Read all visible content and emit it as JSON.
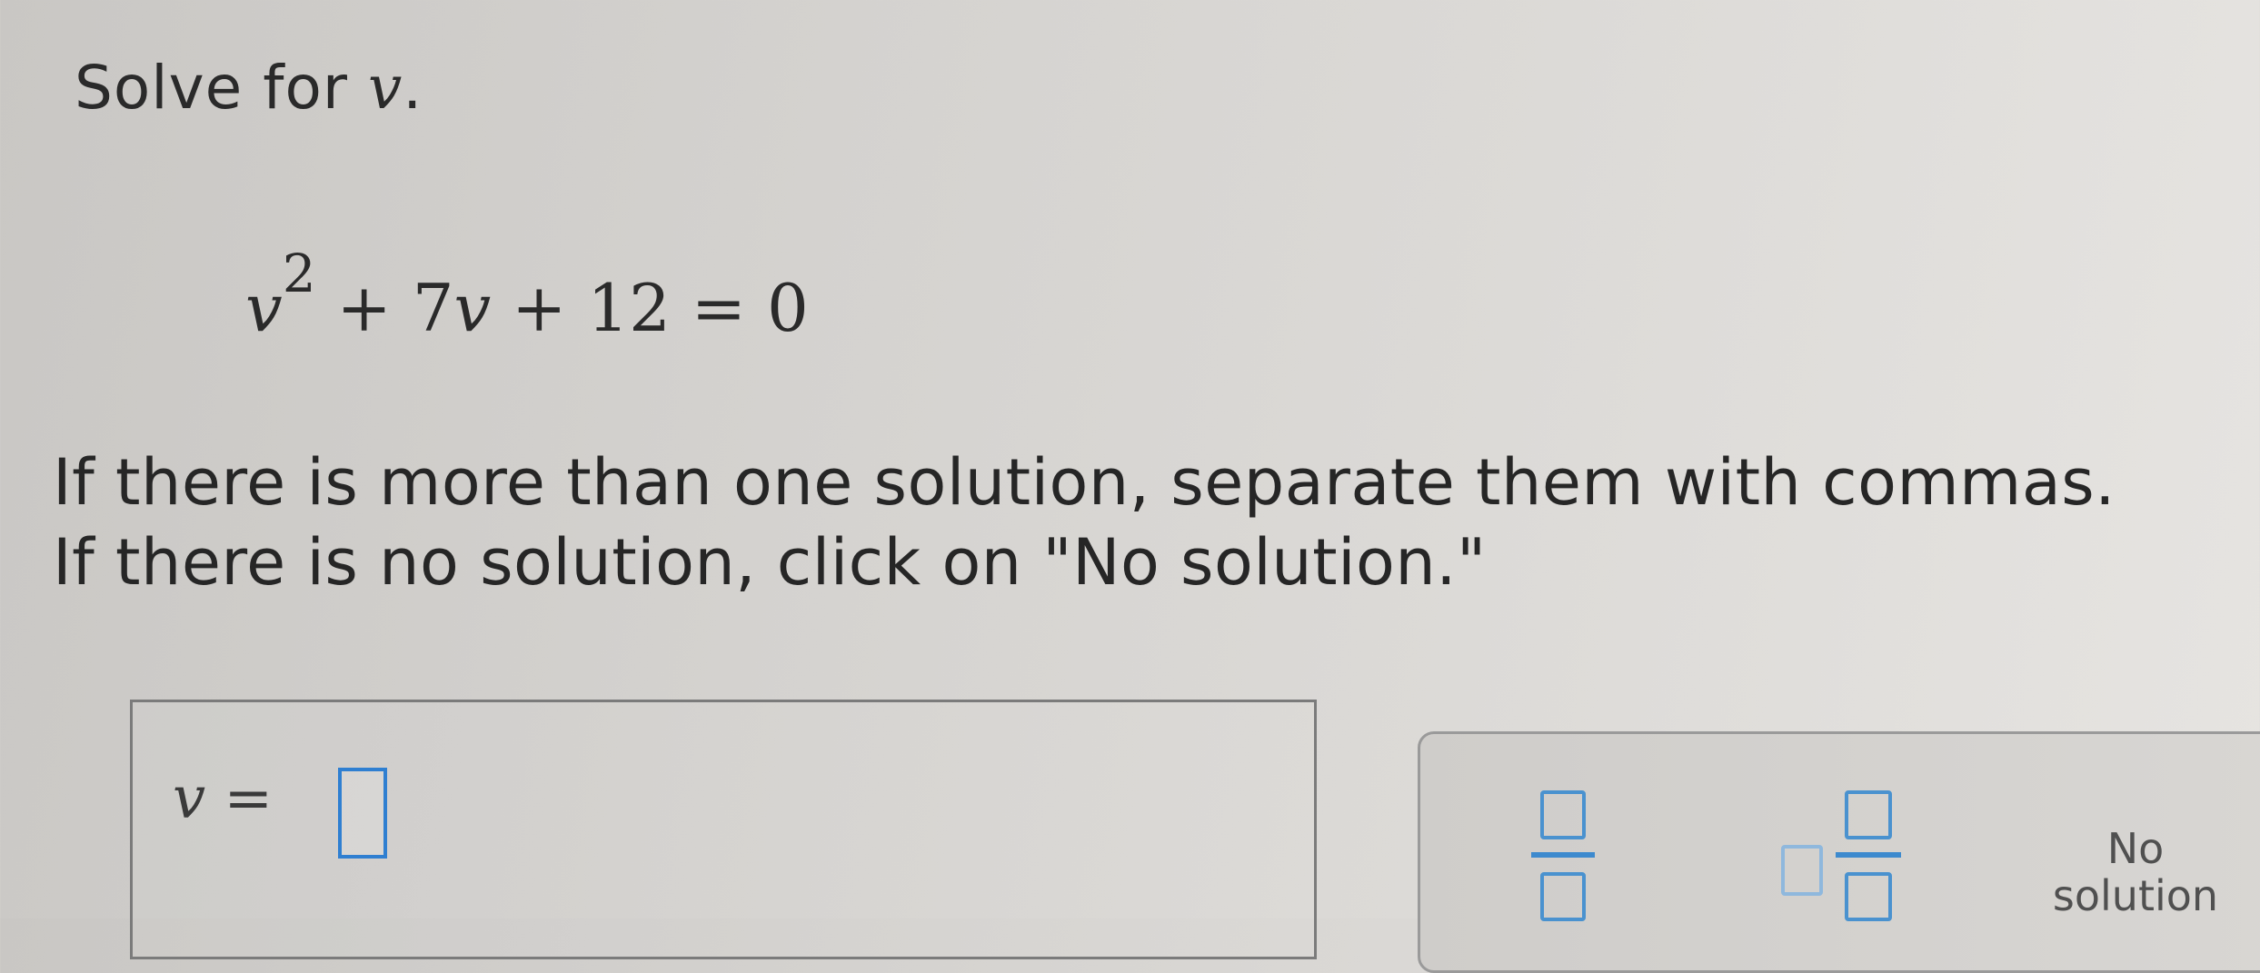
{
  "question": {
    "prompt_text": "Solve for ",
    "prompt_var": "v",
    "prompt_end": "."
  },
  "equation": {
    "base": "v",
    "exponent": "2",
    "rest": " + 7",
    "var2": "v",
    "tail": " + 12 = 0"
  },
  "instructions": {
    "line1": "If there is more than one solution, separate them with commas.",
    "line2": "If there is no solution, click on \"No solution.\""
  },
  "answer": {
    "var": "v",
    "equals": " = ",
    "value": ""
  },
  "tools": {
    "fraction_icon": "fraction-template-icon",
    "mixed_icon": "mixed-number-template-icon",
    "no_solution_line1": "No",
    "no_solution_line2": "solution"
  },
  "colors": {
    "input_border": "#2f7fd1",
    "template_blue": "#4a92cf"
  }
}
